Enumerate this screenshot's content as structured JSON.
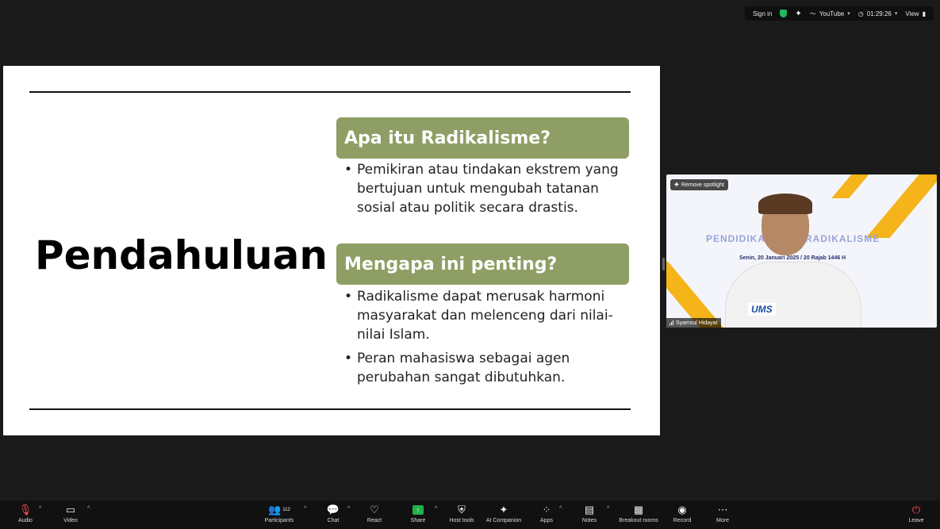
{
  "topbar": {
    "sign_in": "Sign in",
    "youtube": "YouTube",
    "timer": "01:29:26",
    "view": "View"
  },
  "slide": {
    "title": "Pendahuluan",
    "section1": {
      "heading": "Apa itu Radikalisme?",
      "bullets": [
        "Pemikiran atau tindakan ekstrem yang bertujuan untuk mengubah tatanan sosial atau politik secara drastis."
      ]
    },
    "section2": {
      "heading": "Mengapa ini penting?",
      "bullets": [
        "Radikalisme dapat merusak harmoni masyarakat dan melenceng dari nilai-nilai Islam.",
        "Peran mahasiswa sebagai agen perubahan sangat dibutuhkan."
      ]
    }
  },
  "video": {
    "spotlight_label": "Remove spotlight",
    "name": "Syamsul Hidayat",
    "bg_title": "PENDIDIKAN ANTI RADIKALISME",
    "bg_date": "Senin, 20 Januari 2025 / 20 Rajab 1446 H",
    "logo": "UMS"
  },
  "toolbar": {
    "audio": "Audio",
    "video": "Video",
    "participants": "Participants",
    "participants_count": "112",
    "chat": "Chat",
    "react": "React",
    "share": "Share",
    "host_tools": "Host tools",
    "ai_companion": "AI Companion",
    "apps": "Apps",
    "notes": "Notes",
    "breakout": "Breakout rooms",
    "record": "Record",
    "more": "More",
    "leave": "Leave"
  },
  "colors": {
    "banner": "#8f9e64",
    "share": "#22b04b",
    "leave": "#ff4b4b",
    "stripe": "#f4b41a"
  }
}
